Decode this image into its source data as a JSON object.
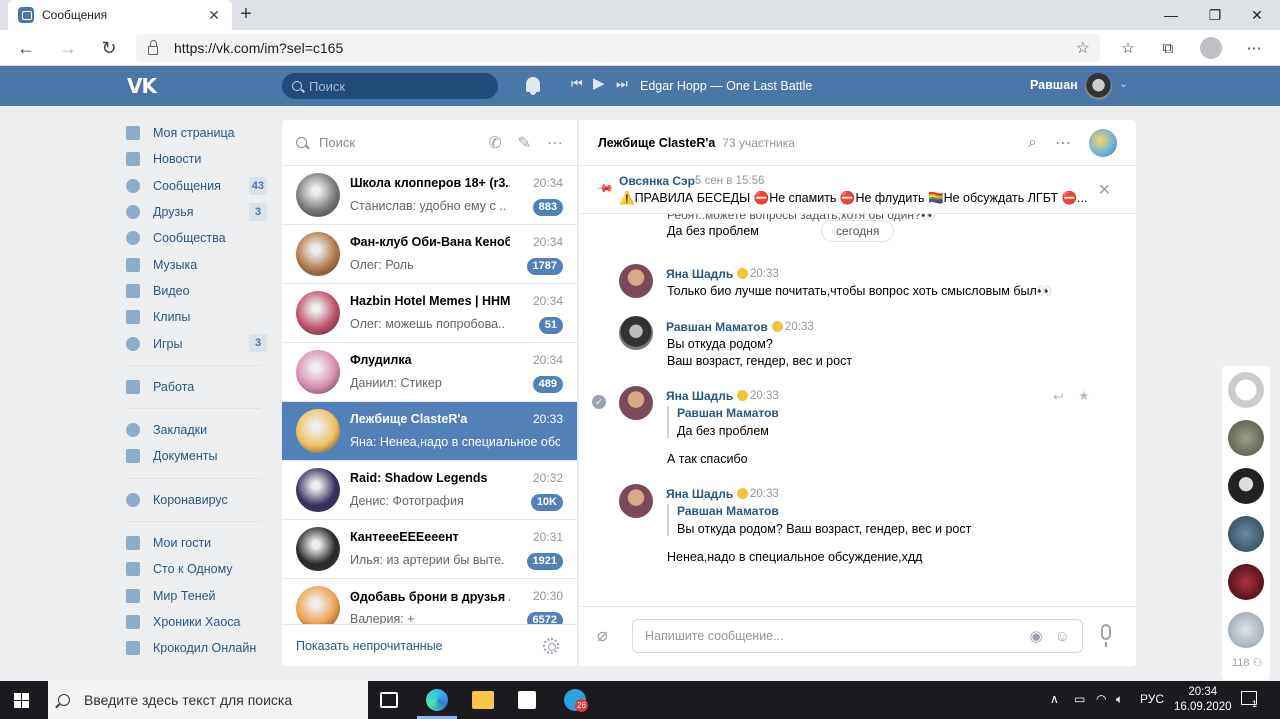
{
  "browser": {
    "tab_title": "Сообщения",
    "url": "https://vk.com/im?sel=c165"
  },
  "vk_header": {
    "search_placeholder": "Поиск",
    "track": "Edgar Hopp — One Last Battle",
    "username": "Равшан"
  },
  "menu": {
    "items": [
      {
        "label": "Моя страница",
        "badge": ""
      },
      {
        "label": "Новости",
        "badge": ""
      },
      {
        "label": "Сообщения",
        "badge": "43"
      },
      {
        "label": "Друзья",
        "badge": "3"
      },
      {
        "label": "Сообщества",
        "badge": ""
      },
      {
        "label": "Музыка",
        "badge": ""
      },
      {
        "label": "Видео",
        "badge": ""
      },
      {
        "label": "Клипы",
        "badge": ""
      },
      {
        "label": "Игры",
        "badge": "3"
      }
    ],
    "work": "Работа",
    "bookmarks": "Закладки",
    "documents": "Документы",
    "corona": "Коронавирус",
    "apps": [
      "Мои гости",
      "Сто к Одному",
      "Мир Теней",
      "Хроники Хаоса",
      "Крокодил Онлайн"
    ]
  },
  "dialog_list": {
    "search_placeholder": "Поиск",
    "footer_link": "Показать непрочитанные",
    "dialogs": [
      {
        "name": "Школа клопперов 18+ (r3...",
        "time": "20:34",
        "preview": "Станислав: удобно ему с ...",
        "unread": "883",
        "color": "#7a7a7a"
      },
      {
        "name": "Фан-клуб Оби-Вана Кеноби",
        "time": "20:34",
        "preview": "Олег: Роль",
        "unread": "1787",
        "color": "#b07a4a"
      },
      {
        "name": "Hazbin Hotel Memes | HHM",
        "time": "20:34",
        "preview": "Олег: можешь попробова...",
        "unread": "51",
        "color": "#c0506a"
      },
      {
        "name": "Флудилка",
        "time": "20:34",
        "preview": "Даниил: Стикер",
        "unread": "489",
        "color": "#d98fb0"
      },
      {
        "name": "Лежбище ClasteR'a",
        "time": "20:33",
        "preview": "Яна: Ненеа,надо в специальное обсу...",
        "unread": "",
        "color": "#f0c060"
      },
      {
        "name": "Raid: Shadow Legends",
        "time": "20:32",
        "preview": "Денис: Фотография",
        "unread": "10K",
        "color": "#3a3060"
      },
      {
        "name": "КантеееЕЕЕееент",
        "time": "20:31",
        "preview": "Илья: из артерии бы выте...",
        "unread": "1921",
        "color": "#2a2a2a"
      },
      {
        "name": "Ꙩдобавь брони в друзья ...",
        "time": "20:30",
        "preview": "Валерия: +",
        "unread": "6572",
        "color": "#f0a050"
      }
    ]
  },
  "chat": {
    "title": "Лежбище ClasteR'a",
    "members": "73 участника",
    "pinned": {
      "author": "Овсянка Сэр",
      "time": "5 сен в 15:56",
      "text": "⚠️ПРАВИЛА БЕСЕДЫ ⛔Не спамить ⛔Не флудить 🏳️‍🌈Не обсуждать ЛГБТ ⛔..."
    },
    "cut_line": "Ребят..можете вопросы задать,хотя бы один?👀",
    "first_text": "Да без проблем",
    "today": "сегодня",
    "messages": [
      {
        "author": "Яна Шадль",
        "time": "20:33",
        "lines": [
          "Только био лучше почитать,чтобы вопрос хоть смысловым был👀"
        ]
      },
      {
        "author": "Равшан Маматов",
        "time": "20:33",
        "lines": [
          "Вы откуда родом?",
          "Ваш возраст, гендер, вес и рост"
        ]
      },
      {
        "author": "Яна Шадль",
        "time": "20:33",
        "reply_author": "Равшан Маматов",
        "reply_text": "Да без проблем",
        "text": "А так спасибо"
      },
      {
        "author": "Яна Шадль",
        "time": "20:33",
        "reply_author": "Равшан Маматов",
        "reply_text": "Вы откуда родом? Ваш возраст, гендер, вес и рост",
        "text": "Ненеа,надо в специальное обсуждение,хдд"
      }
    ],
    "composer_placeholder": "Напишите сообщение..."
  },
  "rail": {
    "count": "118"
  },
  "taskbar": {
    "search_placeholder": "Введите здесь текст для поиска",
    "lang": "РУС",
    "time": "20:34",
    "date": "16.09.2020",
    "telegram_badge": "26",
    "notif_count": "1"
  }
}
